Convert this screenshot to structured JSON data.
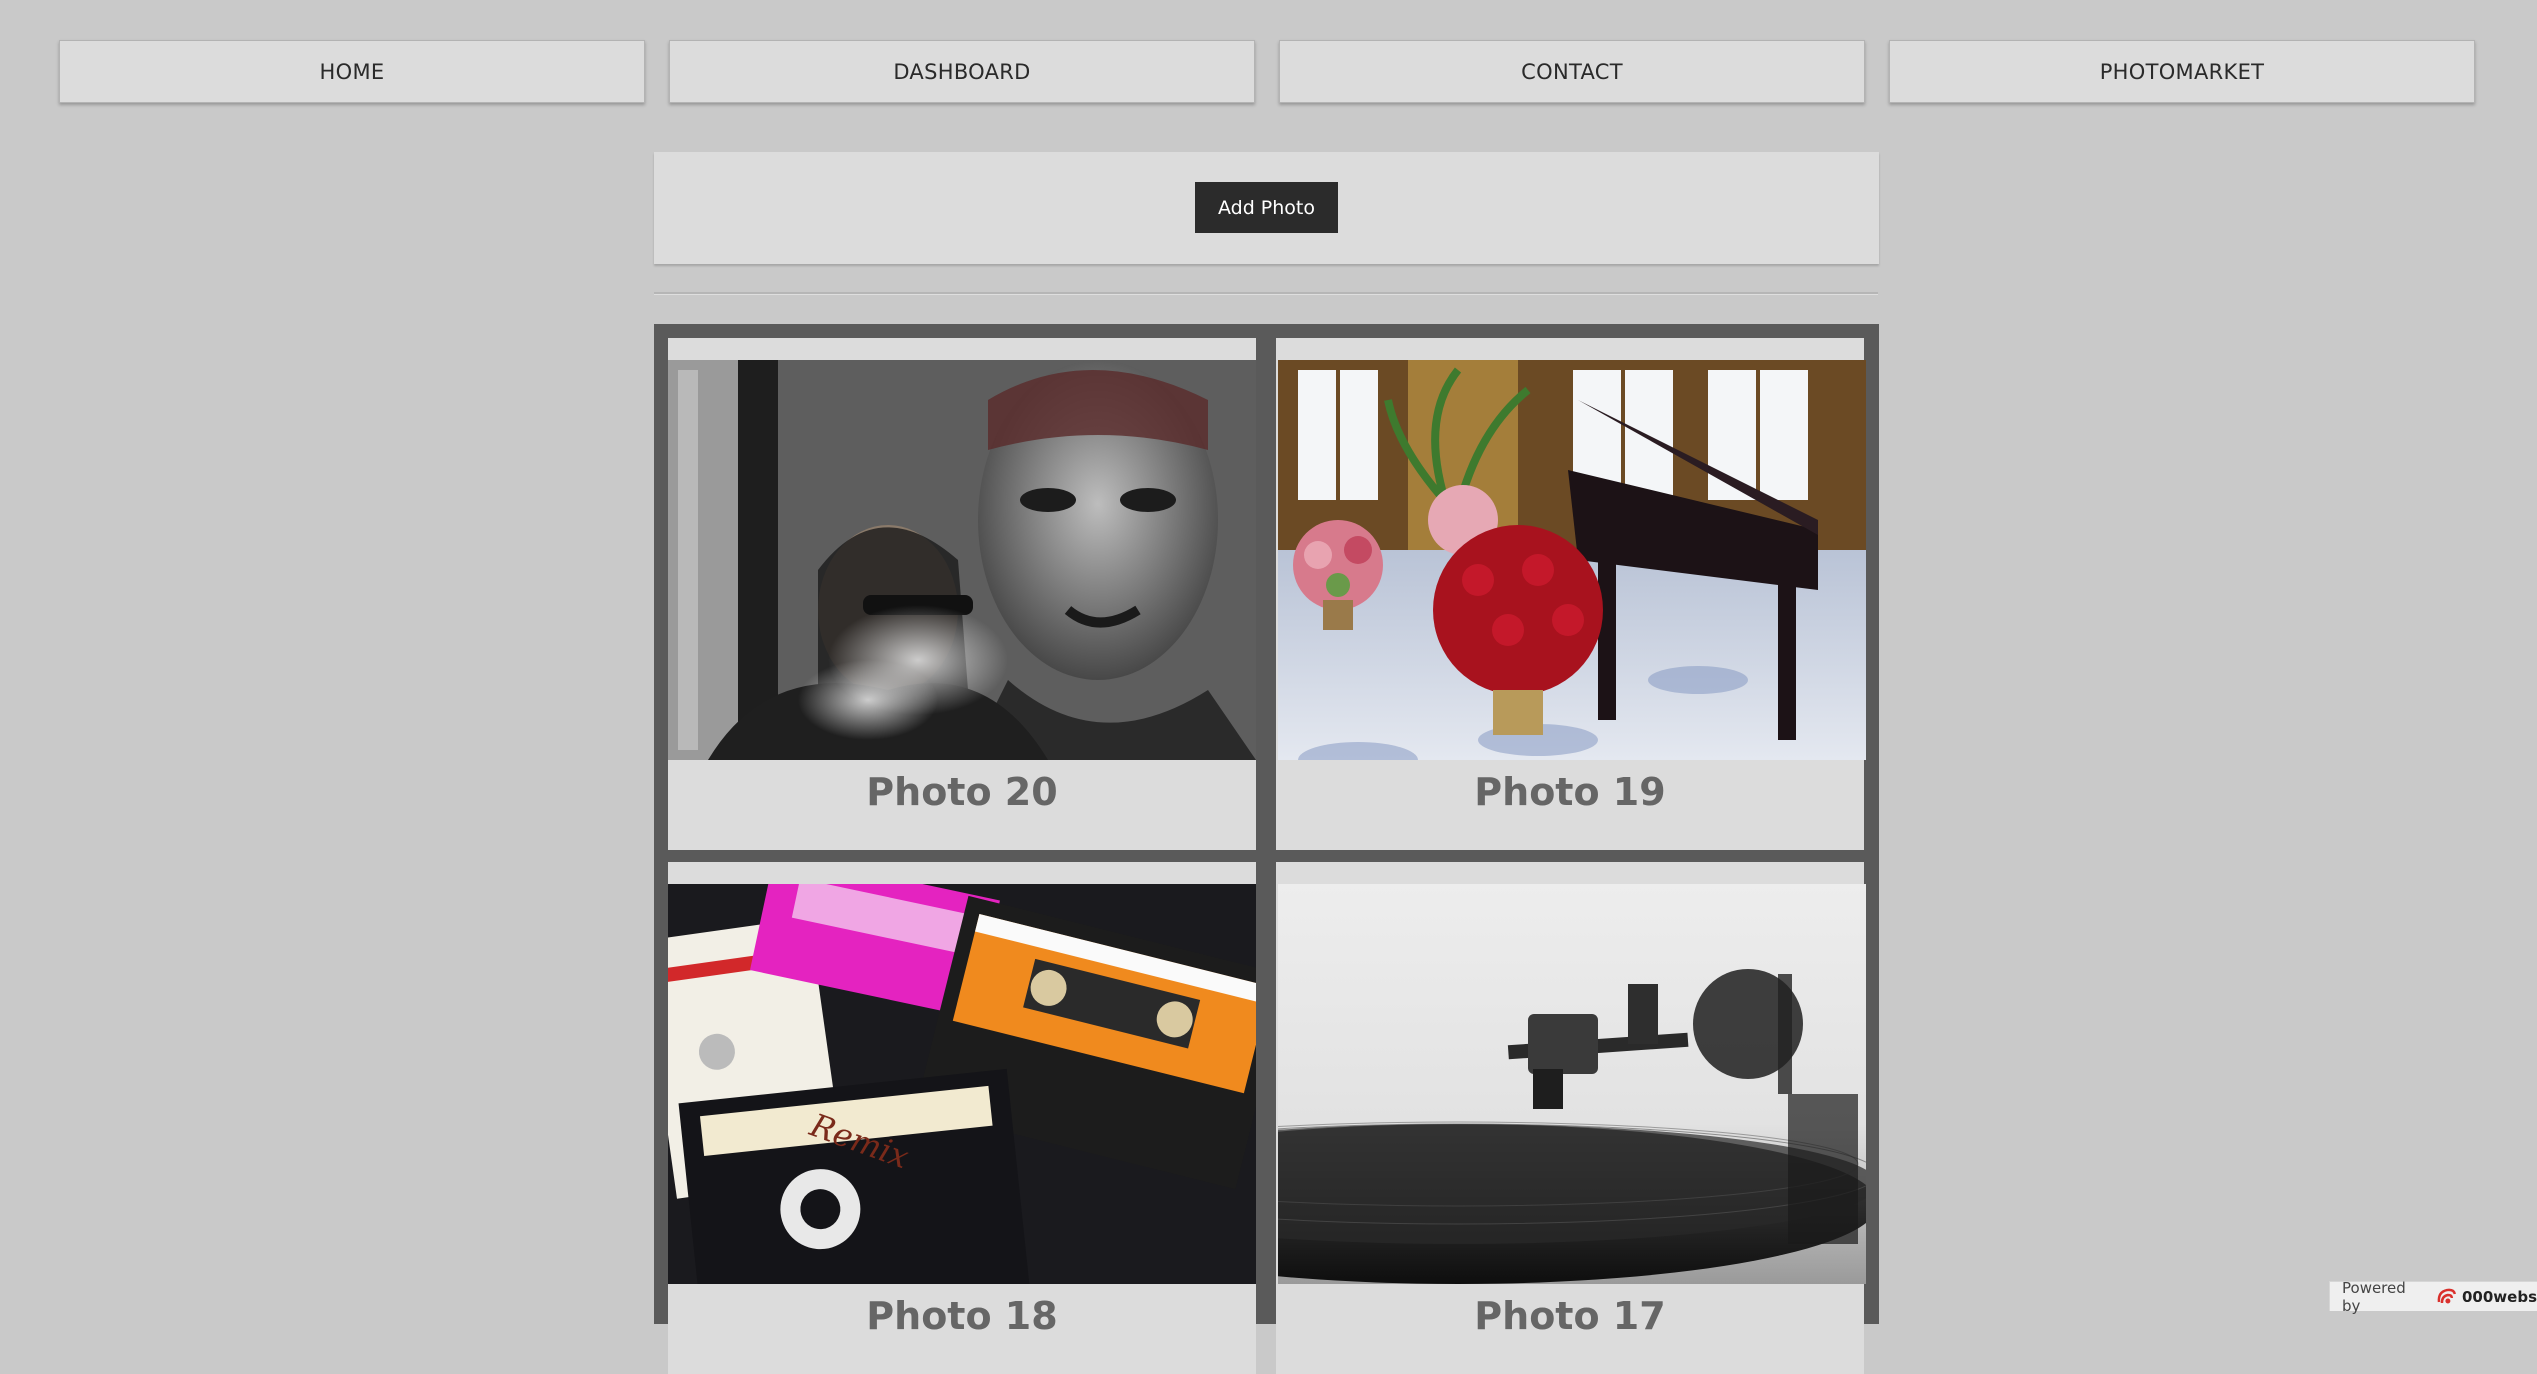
{
  "nav": {
    "items": [
      {
        "label": "HOME"
      },
      {
        "label": "DASHBOARD"
      },
      {
        "label": "CONTACT"
      },
      {
        "label": "PHOTOMARKET"
      }
    ]
  },
  "toolbar": {
    "add_photo_label": "Add Photo"
  },
  "gallery": {
    "photos": [
      {
        "title": "Photo 20"
      },
      {
        "title": "Photo 19"
      },
      {
        "title": "Photo 18"
      },
      {
        "title": "Photo 17"
      }
    ]
  },
  "footer": {
    "powered_by": "Powered by",
    "brand": "000webs"
  },
  "colors": {
    "background": "#c9c9c9",
    "nav_button": "#dcdcdc",
    "add_button": "#2b2b2b",
    "gallery_frame": "#5a5a5a",
    "caption_text": "#666666",
    "logo_red": "#d9302c"
  }
}
